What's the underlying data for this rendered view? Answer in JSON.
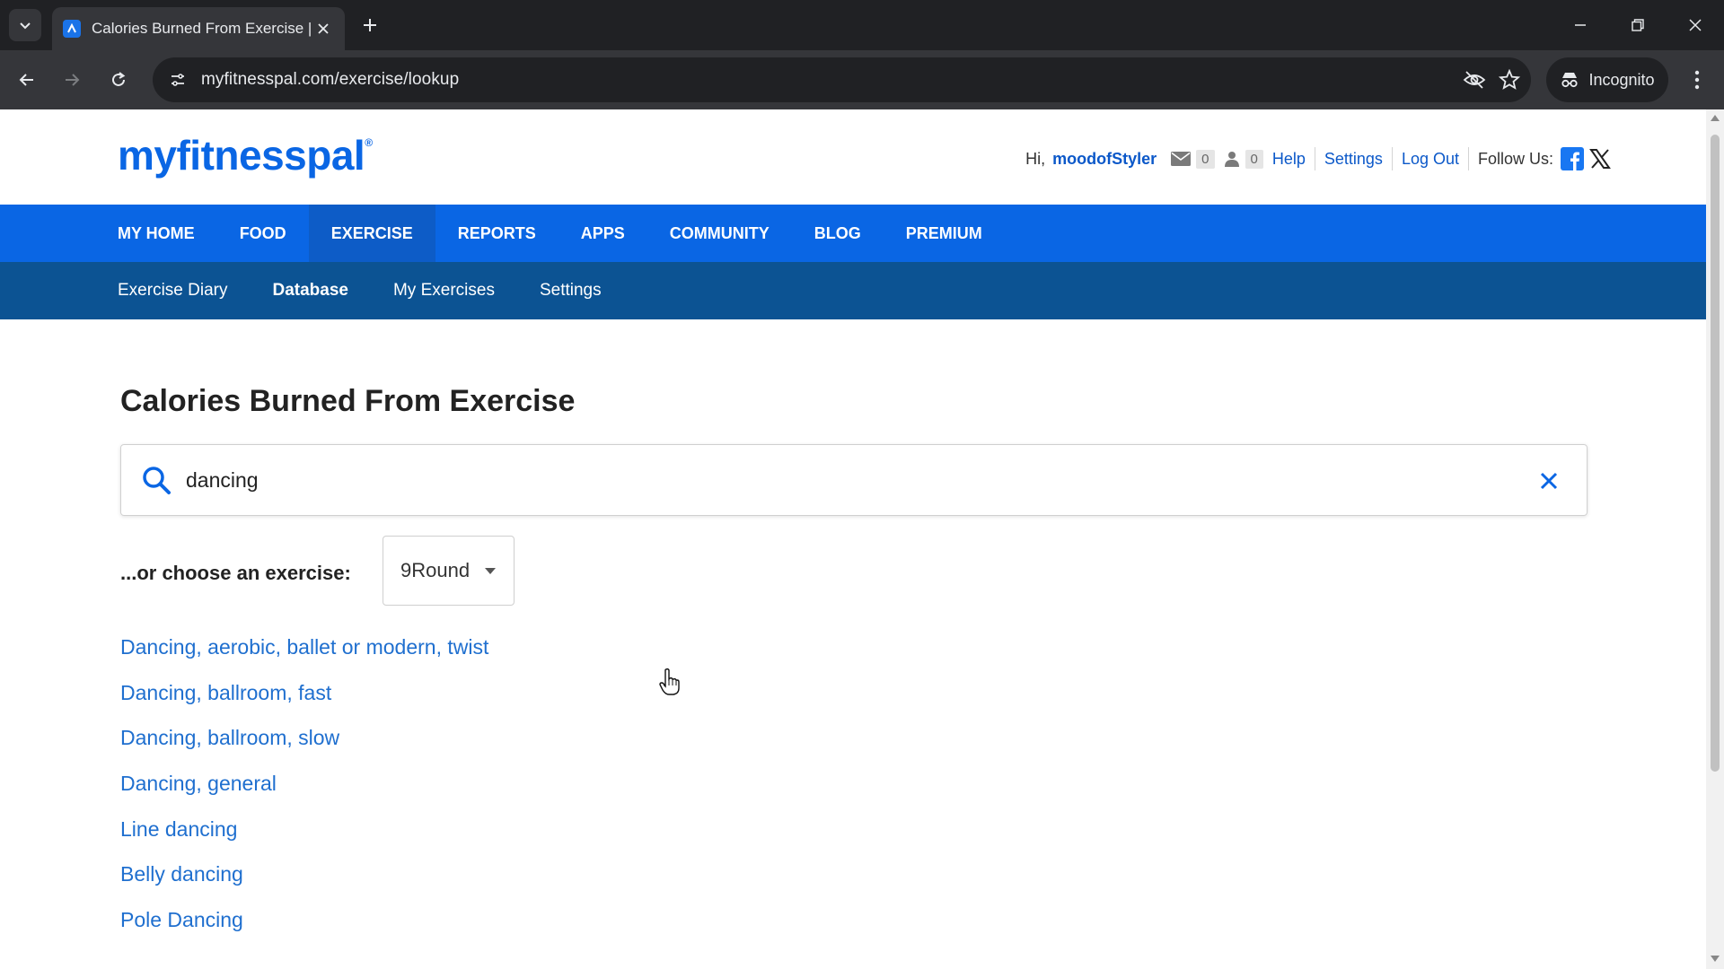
{
  "browser": {
    "tab_title": "Calories Burned From Exercise |",
    "url": "myfitnesspal.com/exercise/lookup",
    "incognito_label": "Incognito"
  },
  "site": {
    "logo": "myfitnesspal",
    "logo_mark": "®",
    "greeting": "Hi,",
    "username": "moodofStyler",
    "messages_count": "0",
    "friends_count": "0",
    "help_label": "Help",
    "settings_label": "Settings",
    "logout_label": "Log Out",
    "follow_label": "Follow Us:",
    "brand_color": "#0a66e4",
    "subnav_color": "#0c5393"
  },
  "mainnav": {
    "items": [
      {
        "label": "MY HOME"
      },
      {
        "label": "FOOD"
      },
      {
        "label": "EXERCISE"
      },
      {
        "label": "REPORTS"
      },
      {
        "label": "APPS"
      },
      {
        "label": "COMMUNITY"
      },
      {
        "label": "BLOG"
      },
      {
        "label": "PREMIUM"
      }
    ],
    "active": "EXERCISE"
  },
  "subnav": {
    "items": [
      {
        "label": "Exercise Diary"
      },
      {
        "label": "Database"
      },
      {
        "label": "My Exercises"
      },
      {
        "label": "Settings"
      }
    ],
    "active": "Database"
  },
  "main": {
    "title": "Calories Burned From Exercise",
    "search_value": "dancing",
    "choose_label": "...or choose an exercise:",
    "selected_exercise": "9Round",
    "results": [
      "Dancing, aerobic, ballet or modern, twist",
      "Dancing, ballroom, fast",
      "Dancing, ballroom, slow",
      "Dancing, general",
      "Line dancing",
      "Belly dancing",
      "Pole Dancing"
    ]
  }
}
